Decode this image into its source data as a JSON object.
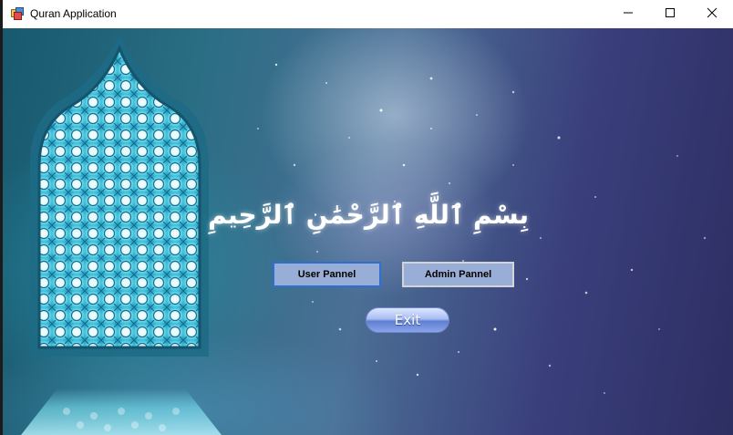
{
  "window": {
    "title": "Quran Application"
  },
  "icons": {
    "app": "app-window-icon",
    "minimize": "minimize-icon",
    "maximize": "maximize-icon",
    "close": "close-icon"
  },
  "main": {
    "bismillah": "بِسْمِ ٱللَّهِ ٱلرَّحْمَٰنِ ٱلرَّحِيمِ",
    "user_button": "User Pannel",
    "admin_button": "Admin Pannel",
    "exit_button": "Exit"
  },
  "colors": {
    "panel_button_bg": "#98aed6",
    "focus_border": "#2f6fd0",
    "exit_gradient_top": "#dbe6ff",
    "exit_gradient_bottom": "#5f7fd2"
  }
}
